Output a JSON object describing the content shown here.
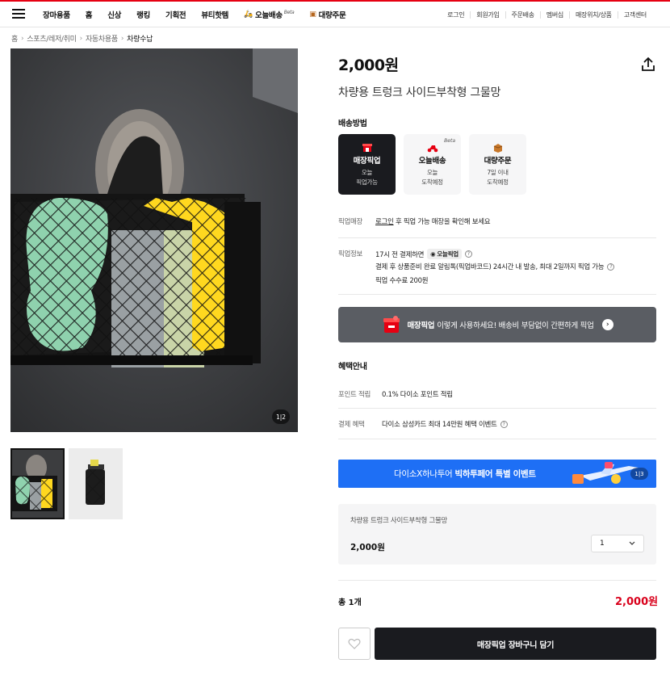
{
  "gnb": {
    "menu": [
      {
        "label": "장마용품"
      },
      {
        "label": "홈"
      },
      {
        "label": "신상"
      },
      {
        "label": "랭킹"
      },
      {
        "label": "기획전"
      },
      {
        "label": "뷰티핫템"
      },
      {
        "label": "오늘배송",
        "beta": "Beta"
      },
      {
        "label": "대량주문"
      }
    ],
    "util": [
      "로그인",
      "회원가입",
      "주문배송",
      "멤버십",
      "매장위치/상품",
      "고객센터"
    ]
  },
  "breadcrumb": [
    "홈",
    "스포츠/레저/취미",
    "자동차용품",
    "차량수납"
  ],
  "gallery": {
    "counter": "1|2"
  },
  "product": {
    "price": "2,000원",
    "title": "차량용 트렁크 사이드부착형 그물망"
  },
  "delivery": {
    "label": "배송방법",
    "options": [
      {
        "name": "매장픽업",
        "sub": "오늘\n픽업가능",
        "active": true
      },
      {
        "name": "오늘배송",
        "sub": "오늘\n도착예정",
        "beta": "Beta"
      },
      {
        "name": "대량주문",
        "sub": "7일 이내\n도착예정"
      }
    ]
  },
  "pickup_store": {
    "label": "픽업매장",
    "login_link": "로그인",
    "text": "후 픽업 가능 매장을 확인해 보세요"
  },
  "pickup_info": {
    "label": "픽업정보",
    "line1": "17시 전 결제하면",
    "badge": "오늘픽업",
    "line2": "결제 후 상품준비 완료 알림톡(픽업바코드) 24시간 내 발송, 최대 2일까지 픽업 가능",
    "line3": "픽업 수수료 200원"
  },
  "pickup_banner": {
    "bold": "매장픽업",
    "text": "이렇게 사용하세요! 배송비 부담없이 간편하게 픽업"
  },
  "benefits": {
    "label": "혜택안내",
    "point_label": "포인트 적립",
    "point_text": "0.1% 다이소 포인트 적립",
    "pay_label": "결제 혜택",
    "pay_text": "다이소 삼성카드 최대 14만원 혜택 이벤트"
  },
  "event_banner": {
    "text_pre": "다이소X하나투어 ",
    "text_bold": "빅하투페어 특별 이벤트",
    "counter": "1|3"
  },
  "option": {
    "name": "차량용 트렁크 사이드부착형 그물망",
    "price": "2,000원",
    "qty": "1"
  },
  "total": {
    "label": "총 1개",
    "price": "2,000원"
  },
  "cart_button": "매장픽업 장바구니 담기",
  "colors": {
    "accent_red": "#d9001b",
    "dark": "#1a1b1f",
    "event_blue": "#1e6ff5"
  }
}
